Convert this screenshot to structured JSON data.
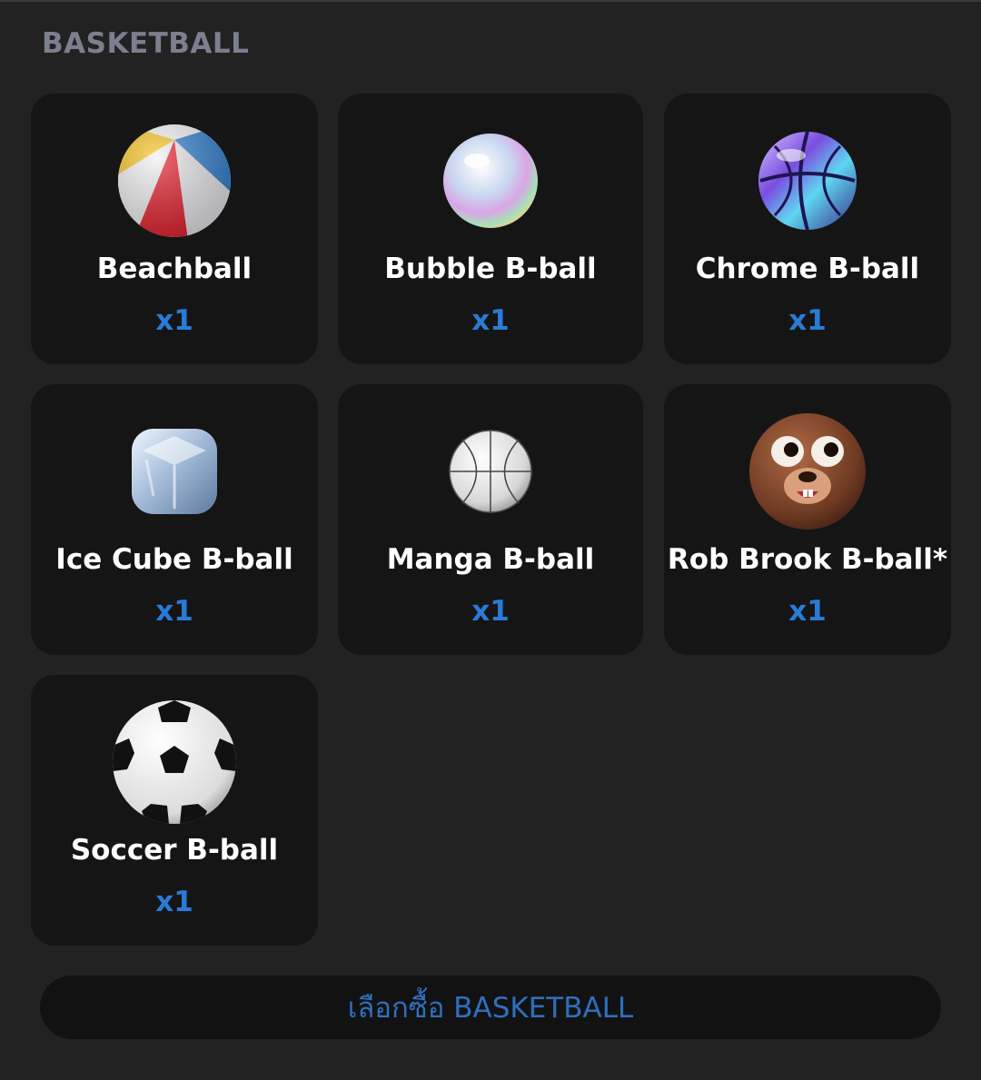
{
  "section": {
    "title": "BASKETBALL"
  },
  "items": [
    {
      "name": "Beachball",
      "qty": "x1",
      "icon": "beachball-icon"
    },
    {
      "name": "Bubble B-ball",
      "qty": "x1",
      "icon": "bubble-ball-icon"
    },
    {
      "name": "Chrome B-ball",
      "qty": "x1",
      "icon": "chrome-ball-icon"
    },
    {
      "name": "Ice Cube B-ball",
      "qty": "x1",
      "icon": "ice-cube-icon"
    },
    {
      "name": "Manga B-ball",
      "qty": "x1",
      "icon": "manga-ball-icon"
    },
    {
      "name": "Rob Brook B-ball*",
      "qty": "x1",
      "icon": "rob-brook-face-icon"
    },
    {
      "name": "Soccer B-ball",
      "qty": "x1",
      "icon": "soccer-ball-icon"
    }
  ],
  "cta": {
    "label": "เลือกซื้อ BASKETBALL"
  },
  "colors": {
    "background": "#222223",
    "card": "#151515",
    "accent": "#2a7bd8",
    "title": "#7b7f8e"
  }
}
